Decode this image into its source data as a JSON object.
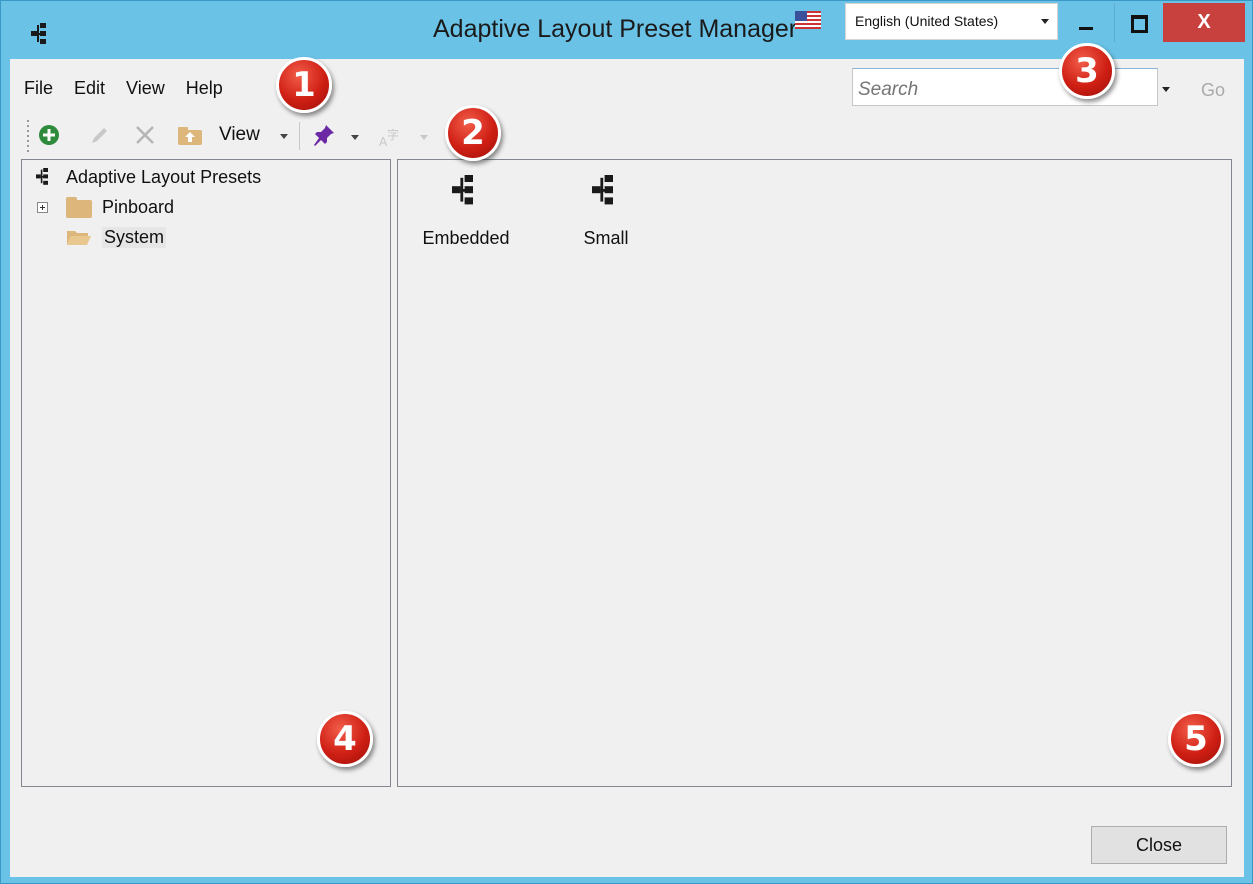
{
  "window": {
    "title": "Adaptive Layout Preset Manager",
    "language": "English (United States)",
    "close_glyph": "X"
  },
  "menu": [
    "File",
    "Edit",
    "View",
    "Help"
  ],
  "toolbar": {
    "view_label": "View",
    "items": [
      "add-icon",
      "edit-icon",
      "delete-icon",
      "folder-up-icon",
      "view-dropdown",
      "pin-icon",
      "font-icon"
    ]
  },
  "search": {
    "placeholder": "Search",
    "go_label": "Go"
  },
  "tree": {
    "root": "Adaptive Layout Presets",
    "children": [
      "Pinboard",
      "System"
    ]
  },
  "list_items": [
    "Embedded",
    "Small"
  ],
  "footer": {
    "close_label": "Close"
  },
  "callouts": [
    "1",
    "2",
    "3",
    "4",
    "5"
  ],
  "colors": {
    "title_bar": "#6ac3e6",
    "close_button": "#c9413e",
    "callout": "#cf1f14",
    "folder": "#dcb67a",
    "add_icon": "#2e8b3b",
    "pin_icon": "#6b2aa3"
  }
}
